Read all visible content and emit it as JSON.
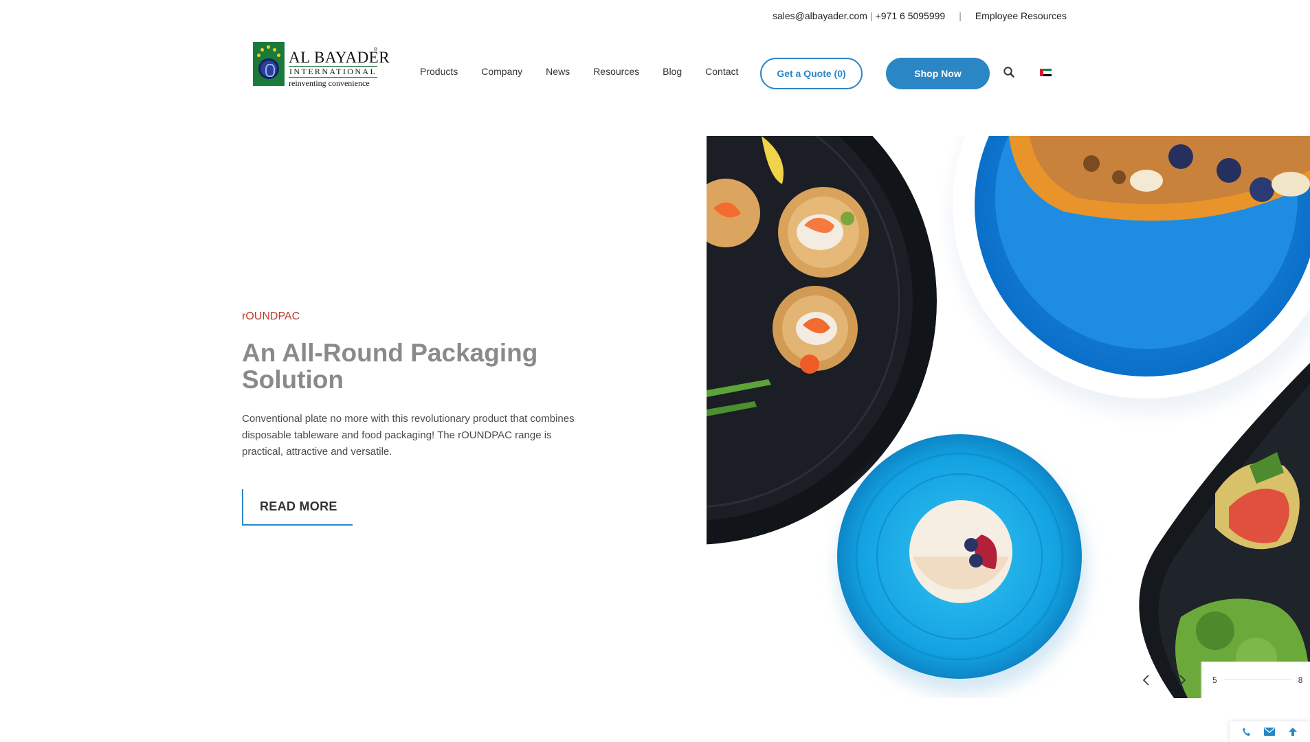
{
  "topbar": {
    "email": "sales@albayader.com",
    "separator": "|",
    "phone": "+971 6 5095999",
    "divider": "|",
    "employee_link": "Employee Resources"
  },
  "logo": {
    "name": "AL BAYADER",
    "sub": "INTERNATIONAL",
    "tagline": "reinventing convenience",
    "reg_mark": "®"
  },
  "nav": {
    "items": [
      {
        "label": "Products"
      },
      {
        "label": "Company"
      },
      {
        "label": "News"
      },
      {
        "label": "Resources"
      },
      {
        "label": "Blog"
      },
      {
        "label": "Contact"
      }
    ],
    "quote_button": "Get a Quote (0)",
    "shop_button": "Shop Now",
    "icons": {
      "search": "search-icon",
      "language": "uae-flag-icon"
    }
  },
  "hero": {
    "eyebrow": "rOUNDPAC",
    "title": "An All-Round Packaging Solution",
    "description": "Conventional plate no more with this revolutionary product that combines disposable tableware and food packaging! The rOUNDPAC range is practical, attractive and versatile.",
    "cta": "READ MORE"
  },
  "slider": {
    "current": "5",
    "total": "8",
    "icons": {
      "prev": "chevron-left-icon",
      "next": "chevron-right-icon"
    }
  },
  "dock": {
    "icons": [
      "phone-icon",
      "envelope-icon",
      "arrow-up-icon"
    ]
  },
  "colors": {
    "accent": "#2b86c5",
    "eyebrow": "#c0392b",
    "headline": "#8a8a8a",
    "brand_green": "#1a7a3c"
  }
}
